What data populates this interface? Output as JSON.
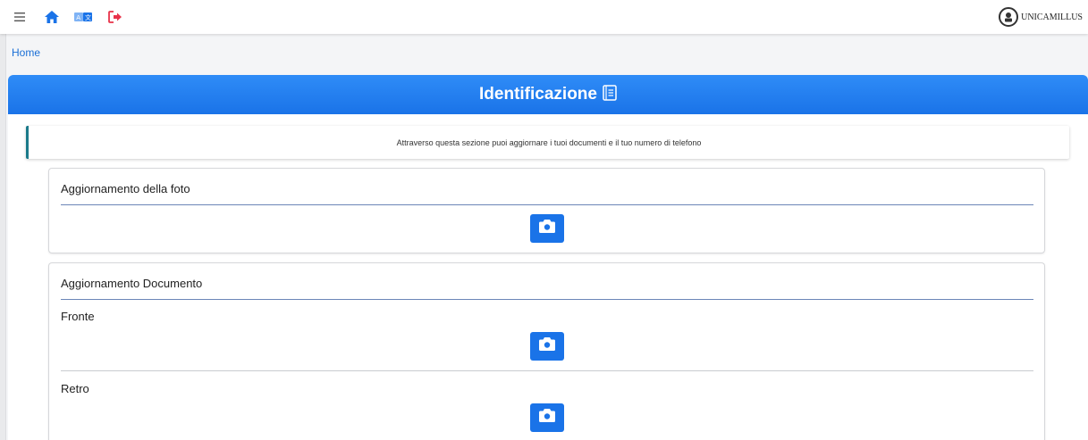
{
  "topbar": {
    "menu_icon": "hamburger-icon",
    "home_icon": "home-icon",
    "language_icon": "translate-icon",
    "logout_icon": "logout-icon",
    "logo_text": "UNICAMILLUS"
  },
  "breadcrumb": {
    "home": "Home"
  },
  "banner": {
    "title": "Identificazione",
    "icon": "document-icon"
  },
  "info": {
    "text": "Attraverso questa sezione puoi aggiornare i tuoi documenti e il tuo numero di telefono"
  },
  "photo_card": {
    "title": "Aggiornamento della foto",
    "camera_icon": "camera-icon"
  },
  "document_card": {
    "title": "Aggiornamento Documento",
    "front_label": "Fronte",
    "back_label": "Retro",
    "camera_icon": "camera-icon"
  },
  "colors": {
    "primary": "#1a73e8",
    "accent_border": "#1b7a8a",
    "logout": "#e8334a",
    "link": "#1a6fd6"
  }
}
